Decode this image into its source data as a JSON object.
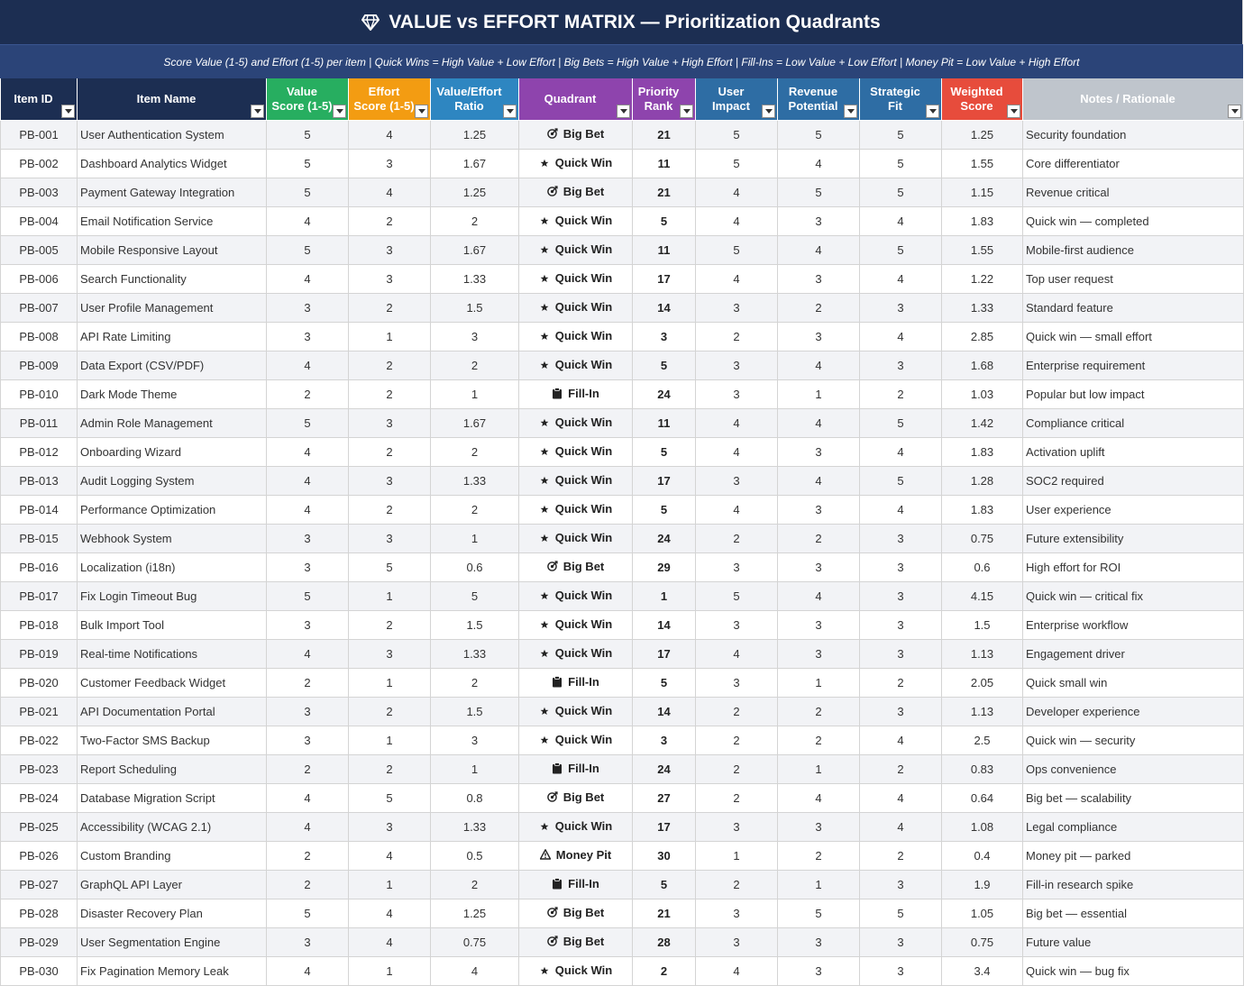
{
  "title": "VALUE vs EFFORT MATRIX — Prioritization Quadrants",
  "subtitle": "Score Value (1-5) and Effort (1-5) per item  |  Quick Wins = High Value + Low Effort  |  Big Bets = High Value + High Effort  |  Fill-Ins = Low Value + Low Effort  |  Money Pit = Low Value + High Effort",
  "colors": {
    "title_bg": "#1c2e52",
    "subtitle_bg": "#2b4478"
  },
  "columns": [
    {
      "key": "id",
      "label": "Item ID",
      "bg": "#1c2e52"
    },
    {
      "key": "name",
      "label": "Item Name",
      "bg": "#1c2e52"
    },
    {
      "key": "value",
      "label": "Value\nScore (1-5)",
      "bg": "#27ae60"
    },
    {
      "key": "effort",
      "label": "Effort\nScore (1-5)",
      "bg": "#f39c12"
    },
    {
      "key": "ratio",
      "label": "Value/Effort\nRatio",
      "bg": "#2e86c1"
    },
    {
      "key": "quadrant",
      "label": "Quadrant",
      "bg": "#8e44ad"
    },
    {
      "key": "rank",
      "label": "Priority\nRank",
      "bg": "#8e44ad"
    },
    {
      "key": "impact",
      "label": "User\nImpact",
      "bg": "#2e6da4"
    },
    {
      "key": "revenue",
      "label": "Revenue\nPotential",
      "bg": "#2e6da4"
    },
    {
      "key": "fit",
      "label": "Strategic\nFit",
      "bg": "#2e6da4"
    },
    {
      "key": "weighted",
      "label": "Weighted\nScore",
      "bg": "#e74c3c"
    },
    {
      "key": "notes",
      "label": "Notes / Rationale",
      "bg": "#bfc5cc"
    }
  ],
  "quadrant_icons": {
    "Big Bet": "target-arrow-icon",
    "Quick Win": "star-icon",
    "Fill-In": "clipboard-icon",
    "Money Pit": "warning-icon"
  },
  "rows": [
    [
      "PB-001",
      "User Authentication System",
      "5",
      "4",
      "1.25",
      "Big Bet",
      "21",
      "5",
      "5",
      "5",
      "1.25",
      "Security foundation"
    ],
    [
      "PB-002",
      "Dashboard Analytics Widget",
      "5",
      "3",
      "1.67",
      "Quick Win",
      "11",
      "5",
      "4",
      "5",
      "1.55",
      "Core differentiator"
    ],
    [
      "PB-003",
      "Payment Gateway Integration",
      "5",
      "4",
      "1.25",
      "Big Bet",
      "21",
      "4",
      "5",
      "5",
      "1.15",
      "Revenue critical"
    ],
    [
      "PB-004",
      "Email Notification Service",
      "4",
      "2",
      "2",
      "Quick Win",
      "5",
      "4",
      "3",
      "4",
      "1.83",
      "Quick win — completed"
    ],
    [
      "PB-005",
      "Mobile Responsive Layout",
      "5",
      "3",
      "1.67",
      "Quick Win",
      "11",
      "5",
      "4",
      "5",
      "1.55",
      "Mobile-first audience"
    ],
    [
      "PB-006",
      "Search Functionality",
      "4",
      "3",
      "1.33",
      "Quick Win",
      "17",
      "4",
      "3",
      "4",
      "1.22",
      "Top user request"
    ],
    [
      "PB-007",
      "User Profile Management",
      "3",
      "2",
      "1.5",
      "Quick Win",
      "14",
      "3",
      "2",
      "3",
      "1.33",
      "Standard feature"
    ],
    [
      "PB-008",
      "API Rate Limiting",
      "3",
      "1",
      "3",
      "Quick Win",
      "3",
      "2",
      "3",
      "4",
      "2.85",
      "Quick win — small effort"
    ],
    [
      "PB-009",
      "Data Export (CSV/PDF)",
      "4",
      "2",
      "2",
      "Quick Win",
      "5",
      "3",
      "4",
      "3",
      "1.68",
      "Enterprise requirement"
    ],
    [
      "PB-010",
      "Dark Mode Theme",
      "2",
      "2",
      "1",
      "Fill-In",
      "24",
      "3",
      "1",
      "2",
      "1.03",
      "Popular but low impact"
    ],
    [
      "PB-011",
      "Admin Role Management",
      "5",
      "3",
      "1.67",
      "Quick Win",
      "11",
      "4",
      "4",
      "5",
      "1.42",
      "Compliance critical"
    ],
    [
      "PB-012",
      "Onboarding Wizard",
      "4",
      "2",
      "2",
      "Quick Win",
      "5",
      "4",
      "3",
      "4",
      "1.83",
      "Activation uplift"
    ],
    [
      "PB-013",
      "Audit Logging System",
      "4",
      "3",
      "1.33",
      "Quick Win",
      "17",
      "3",
      "4",
      "5",
      "1.28",
      "SOC2 required"
    ],
    [
      "PB-014",
      "Performance Optimization",
      "4",
      "2",
      "2",
      "Quick Win",
      "5",
      "4",
      "3",
      "4",
      "1.83",
      "User experience"
    ],
    [
      "PB-015",
      "Webhook System",
      "3",
      "3",
      "1",
      "Quick Win",
      "24",
      "2",
      "2",
      "3",
      "0.75",
      "Future extensibility"
    ],
    [
      "PB-016",
      "Localization (i18n)",
      "3",
      "5",
      "0.6",
      "Big Bet",
      "29",
      "3",
      "3",
      "3",
      "0.6",
      "High effort for ROI"
    ],
    [
      "PB-017",
      "Fix Login Timeout Bug",
      "5",
      "1",
      "5",
      "Quick Win",
      "1",
      "5",
      "4",
      "3",
      "4.15",
      "Quick win — critical fix"
    ],
    [
      "PB-018",
      "Bulk Import Tool",
      "3",
      "2",
      "1.5",
      "Quick Win",
      "14",
      "3",
      "3",
      "3",
      "1.5",
      "Enterprise workflow"
    ],
    [
      "PB-019",
      "Real-time Notifications",
      "4",
      "3",
      "1.33",
      "Quick Win",
      "17",
      "4",
      "3",
      "3",
      "1.13",
      "Engagement driver"
    ],
    [
      "PB-020",
      "Customer Feedback Widget",
      "2",
      "1",
      "2",
      "Fill-In",
      "5",
      "3",
      "1",
      "2",
      "2.05",
      "Quick small win"
    ],
    [
      "PB-021",
      "API Documentation Portal",
      "3",
      "2",
      "1.5",
      "Quick Win",
      "14",
      "2",
      "2",
      "3",
      "1.13",
      "Developer experience"
    ],
    [
      "PB-022",
      "Two-Factor SMS Backup",
      "3",
      "1",
      "3",
      "Quick Win",
      "3",
      "2",
      "2",
      "4",
      "2.5",
      "Quick win — security"
    ],
    [
      "PB-023",
      "Report Scheduling",
      "2",
      "2",
      "1",
      "Fill-In",
      "24",
      "2",
      "1",
      "2",
      "0.83",
      "Ops convenience"
    ],
    [
      "PB-024",
      "Database Migration Script",
      "4",
      "5",
      "0.8",
      "Big Bet",
      "27",
      "2",
      "4",
      "4",
      "0.64",
      "Big bet — scalability"
    ],
    [
      "PB-025",
      "Accessibility (WCAG 2.1)",
      "4",
      "3",
      "1.33",
      "Quick Win",
      "17",
      "3",
      "3",
      "4",
      "1.08",
      "Legal compliance"
    ],
    [
      "PB-026",
      "Custom Branding",
      "2",
      "4",
      "0.5",
      "Money Pit",
      "30",
      "1",
      "2",
      "2",
      "0.4",
      "Money pit — parked"
    ],
    [
      "PB-027",
      "GraphQL API Layer",
      "2",
      "1",
      "2",
      "Fill-In",
      "5",
      "2",
      "1",
      "3",
      "1.9",
      "Fill-in research spike"
    ],
    [
      "PB-028",
      "Disaster Recovery Plan",
      "5",
      "4",
      "1.25",
      "Big Bet",
      "21",
      "3",
      "5",
      "5",
      "1.05",
      "Big bet — essential"
    ],
    [
      "PB-029",
      "User Segmentation Engine",
      "3",
      "4",
      "0.75",
      "Big Bet",
      "28",
      "3",
      "3",
      "3",
      "0.75",
      "Future value"
    ],
    [
      "PB-030",
      "Fix Pagination Memory Leak",
      "4",
      "1",
      "4",
      "Quick Win",
      "2",
      "4",
      "3",
      "3",
      "3.4",
      "Quick win — bug fix"
    ]
  ]
}
